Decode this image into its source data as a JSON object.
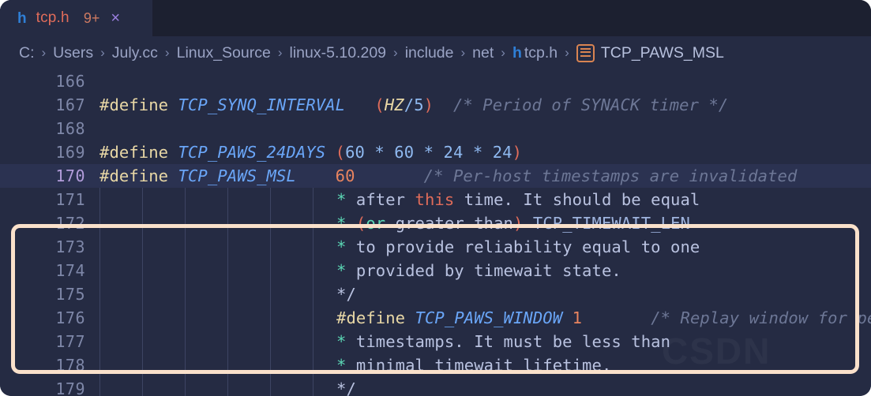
{
  "tab": {
    "file_icon_glyph": "h",
    "file_name": "tcp.h",
    "badge": "9+",
    "close_glyph": "×"
  },
  "breadcrumb": {
    "items": [
      "C:",
      "Users",
      "July.cc",
      "Linux_Source",
      "linux-5.10.209",
      "include",
      "net"
    ],
    "separator": "›",
    "file_icon_glyph": "h",
    "file_name": "tcp.h",
    "symbol_name": "TCP_PAWS_MSL"
  },
  "watermark": "CSDN",
  "editor": {
    "lines": [
      {
        "num": "166",
        "active": false,
        "guides": 0,
        "tokens": []
      },
      {
        "num": "167",
        "active": false,
        "guides": 0,
        "tokens": [
          {
            "t": "#define ",
            "c": "k-directive"
          },
          {
            "t": "TCP_SYNQ_INTERVAL",
            "c": "k-macro"
          },
          {
            "t": "   ",
            "c": "k-cmt-txt"
          },
          {
            "t": "(",
            "c": "k-paren"
          },
          {
            "t": "HZ",
            "c": "k-hz"
          },
          {
            "t": "/",
            "c": "k-op"
          },
          {
            "t": "5",
            "c": "k-num2"
          },
          {
            "t": ")",
            "c": "k-paren"
          },
          {
            "t": "  ",
            "c": "k-cmt-txt"
          },
          {
            "t": "/* Period of SYNACK timer */",
            "c": "k-comment"
          }
        ]
      },
      {
        "num": "168",
        "active": false,
        "guides": 0,
        "tokens": []
      },
      {
        "num": "169",
        "active": false,
        "guides": 0,
        "tokens": [
          {
            "t": "#define ",
            "c": "k-directive"
          },
          {
            "t": "TCP_PAWS_24DAYS ",
            "c": "k-macro"
          },
          {
            "t": "(",
            "c": "k-paren"
          },
          {
            "t": "60",
            "c": "k-num2"
          },
          {
            "t": " * ",
            "c": "k-op"
          },
          {
            "t": "60",
            "c": "k-num2"
          },
          {
            "t": " * ",
            "c": "k-op"
          },
          {
            "t": "24",
            "c": "k-num2"
          },
          {
            "t": " * ",
            "c": "k-op"
          },
          {
            "t": "24",
            "c": "k-num2"
          },
          {
            "t": ")",
            "c": "k-paren"
          }
        ]
      },
      {
        "num": "170",
        "active": true,
        "guides": 0,
        "tokens": [
          {
            "t": "#define ",
            "c": "k-directive"
          },
          {
            "t": "TCP_PAWS_MSL",
            "c": "k-macro"
          },
          {
            "t": "    ",
            "c": "k-cmt-txt"
          },
          {
            "t": "60",
            "c": "k-num"
          },
          {
            "t": "       ",
            "c": "k-cmt-txt"
          },
          {
            "t": "/* Per-host timestamps are invalidated",
            "c": "k-comment"
          }
        ]
      },
      {
        "num": "171",
        "active": false,
        "guides": 6,
        "tokens": [
          {
            "t": "* ",
            "c": "k-cmt-star"
          },
          {
            "t": "after ",
            "c": "k-cmt-txt"
          },
          {
            "t": "this",
            "c": "k-cmt-kw"
          },
          {
            "t": " time. It should be equal",
            "c": "k-cmt-txt"
          }
        ]
      },
      {
        "num": "172",
        "active": false,
        "guides": 6,
        "tokens": [
          {
            "t": "* ",
            "c": "k-cmt-star"
          },
          {
            "t": "(",
            "c": "k-cmt-kw"
          },
          {
            "t": "or",
            "c": "k-cmt-kw2"
          },
          {
            "t": " greater than",
            "c": "k-cmt-txt"
          },
          {
            "t": ")",
            "c": "k-cmt-kw"
          },
          {
            "t": " ",
            "c": "k-cmt-txt"
          },
          {
            "t": "TCP_TIMEWAIT_LEN",
            "c": "k-cmt-id"
          }
        ]
      },
      {
        "num": "173",
        "active": false,
        "guides": 6,
        "tokens": [
          {
            "t": "* ",
            "c": "k-cmt-star"
          },
          {
            "t": "to provide reliability equal to one",
            "c": "k-cmt-txt"
          }
        ]
      },
      {
        "num": "174",
        "active": false,
        "guides": 6,
        "tokens": [
          {
            "t": "* ",
            "c": "k-cmt-star"
          },
          {
            "t": "provided by timewait state.",
            "c": "k-cmt-txt"
          }
        ]
      },
      {
        "num": "175",
        "active": false,
        "guides": 6,
        "tokens": [
          {
            "t": "*/",
            "c": "k-cmt-txt"
          }
        ]
      },
      {
        "num": "176",
        "active": false,
        "guides": 6,
        "tokens": [
          {
            "t": "#define ",
            "c": "k-directive"
          },
          {
            "t": "TCP_PAWS_WINDOW ",
            "c": "k-macro"
          },
          {
            "t": "1",
            "c": "k-num"
          },
          {
            "t": "       ",
            "c": "k-cmt-txt"
          },
          {
            "t": "/* Replay window for per-host",
            "c": "k-comment"
          }
        ]
      },
      {
        "num": "177",
        "active": false,
        "guides": 6,
        "tokens": [
          {
            "t": "* ",
            "c": "k-cmt-star"
          },
          {
            "t": "timestamps. It must be less than",
            "c": "k-cmt-txt"
          }
        ]
      },
      {
        "num": "178",
        "active": false,
        "guides": 6,
        "tokens": [
          {
            "t": "* ",
            "c": "k-cmt-star"
          },
          {
            "t": "minimal timewait lifetime.",
            "c": "k-cmt-txt"
          }
        ]
      },
      {
        "num": "179",
        "active": false,
        "guides": 6,
        "tokens": [
          {
            "t": "*/",
            "c": "k-cmt-txt"
          }
        ]
      }
    ]
  },
  "highlight_box": {
    "border_color": "#fae1cb"
  }
}
